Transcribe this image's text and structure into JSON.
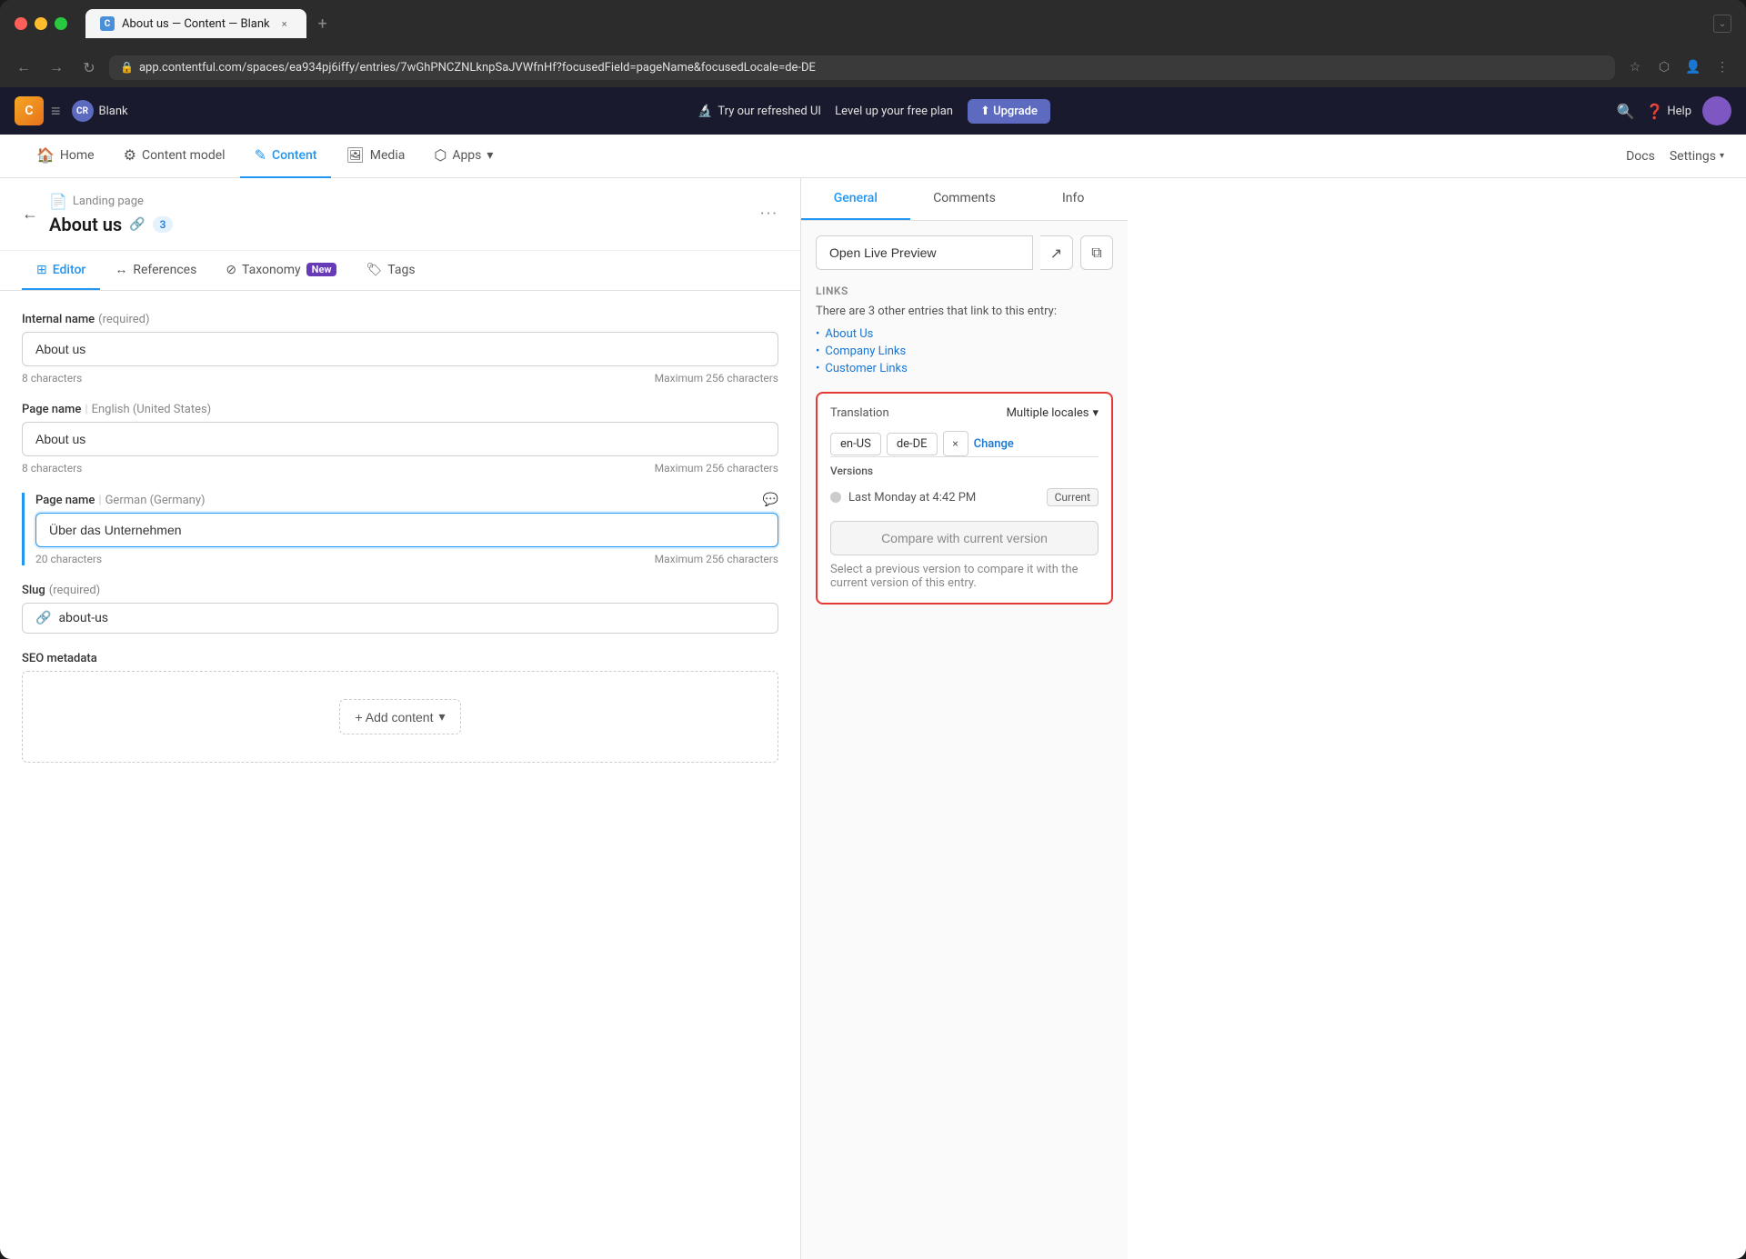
{
  "browser": {
    "tab_title": "About us — Content — Blank",
    "tab_close": "×",
    "new_tab": "+",
    "url": "app.contentful.com/spaces/ea934pj6iffy/entries/7wGhPNCZNLknpSaJVWfnHf?focusedField=pageName&focusedLocale=de-DE",
    "nav_back": "←",
    "nav_forward": "→",
    "nav_reload": "↻"
  },
  "topnav": {
    "logo": "C",
    "hamburger": "≡",
    "workspace_initials": "CR",
    "workspace_name": "Blank",
    "notification_text": "Try our refreshed UI",
    "notification_sub": "Level up your free plan",
    "upgrade_label": "Upgrade",
    "docs_label": "Docs",
    "settings_label": "Settings",
    "help_label": "Help"
  },
  "secondarynav": {
    "items": [
      {
        "label": "Home",
        "icon": "🏠",
        "active": false
      },
      {
        "label": "Content model",
        "icon": "⚙",
        "active": false
      },
      {
        "label": "Content",
        "icon": "✎",
        "active": true
      },
      {
        "label": "Media",
        "icon": "🖼",
        "active": false
      },
      {
        "label": "Apps",
        "icon": "⬡",
        "active": false,
        "has_dropdown": true
      }
    ],
    "right_items": [
      {
        "label": "Docs"
      },
      {
        "label": "Settings",
        "has_dropdown": true
      }
    ]
  },
  "entry": {
    "breadcrumb": "Landing page",
    "title": "About us",
    "link_count": "3",
    "back_label": "←"
  },
  "tabs": [
    {
      "label": "Editor",
      "icon": "⊞",
      "active": true
    },
    {
      "label": "References",
      "icon": "↔",
      "active": false
    },
    {
      "label": "Taxonomy",
      "icon": "⊘",
      "active": false,
      "badge": "New"
    },
    {
      "label": "Tags",
      "icon": "🏷",
      "active": false
    }
  ],
  "form": {
    "internal_name_label": "Internal name",
    "internal_name_required": "(required)",
    "internal_name_value": "About us",
    "internal_name_chars": "8 characters",
    "internal_name_max": "Maximum 256 characters",
    "page_name_label": "Page name",
    "page_name_locale": "English (United States)",
    "page_name_value": "About us",
    "page_name_chars": "8 characters",
    "page_name_max": "Maximum 256 characters",
    "page_name_de_label": "Page name",
    "page_name_de_locale": "German (Germany)",
    "page_name_de_value": "Über das Unternehmen",
    "page_name_de_chars": "20 characters",
    "page_name_de_max": "Maximum 256 characters",
    "slug_label": "Slug",
    "slug_required": "(required)",
    "slug_value": "about-us",
    "seo_label": "SEO metadata",
    "add_content_label": "+ Add content"
  },
  "rightpanel": {
    "tabs": [
      "General",
      "Comments",
      "Info"
    ],
    "active_tab": "General",
    "preview_btn_label": "Open Live Preview",
    "links_title": "Links",
    "links_description": "There are 3 other entries that link to this entry:",
    "links": [
      {
        "label": "About Us"
      },
      {
        "label": "Company Links"
      },
      {
        "label": "Customer Links"
      }
    ],
    "translation_label": "Translation",
    "translation_locale": "Multiple locales",
    "locale_tag_1": "en-US",
    "locale_tag_2": "de-DE",
    "locale_x": "×",
    "change_label": "Change",
    "versions_title": "Versions",
    "version_time": "Last Monday at 4:42 PM",
    "version_badge": "Current",
    "compare_btn_label": "Compare with current version",
    "compare_hint": "Select a previous version to compare it with the current version of this entry."
  }
}
